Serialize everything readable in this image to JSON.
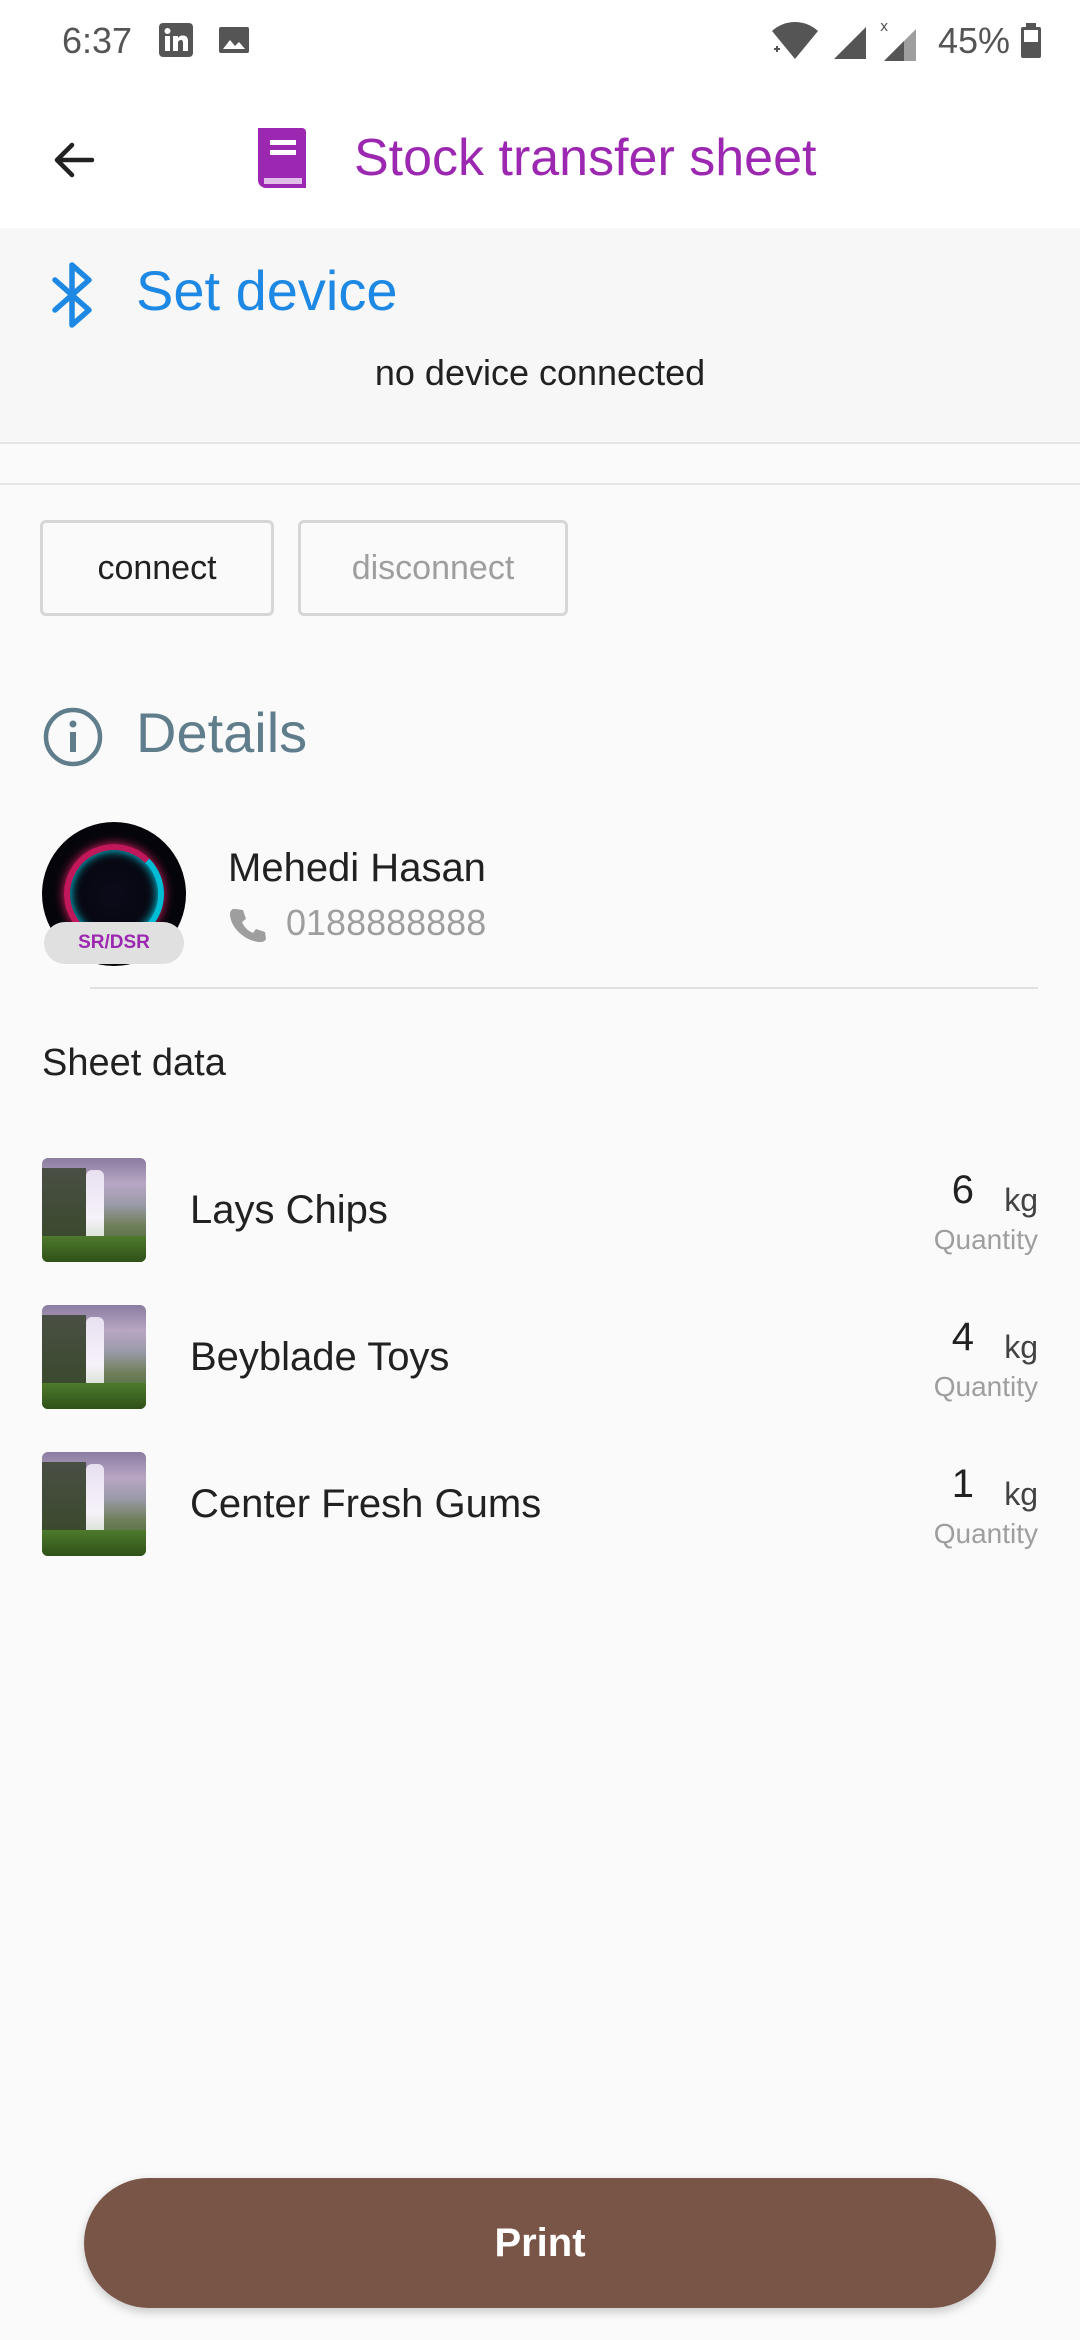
{
  "status_bar": {
    "time": "6:37",
    "battery": "45%"
  },
  "app_bar": {
    "title": "Stock transfer sheet",
    "title_color": "#9c27b0"
  },
  "device": {
    "title": "Set device",
    "status": "no device connected",
    "connect_label": "connect",
    "disconnect_label": "disconnect",
    "accent": "#1e88e5"
  },
  "details": {
    "title": "Details",
    "user": {
      "name": "Mehedi Hasan",
      "phone": "0188888888",
      "role": "SR/DSR"
    }
  },
  "sheet": {
    "title": "Sheet data",
    "items": [
      {
        "name": "Lays Chips",
        "quantity": "6",
        "unit": "kg",
        "quantity_label": "Quantity"
      },
      {
        "name": "Beyblade Toys",
        "quantity": "4",
        "unit": "kg",
        "quantity_label": "Quantity"
      },
      {
        "name": "Center Fresh Gums",
        "quantity": "1",
        "unit": "kg",
        "quantity_label": "Quantity"
      }
    ]
  },
  "actions": {
    "print_label": "Print",
    "print_color": "#795548"
  }
}
